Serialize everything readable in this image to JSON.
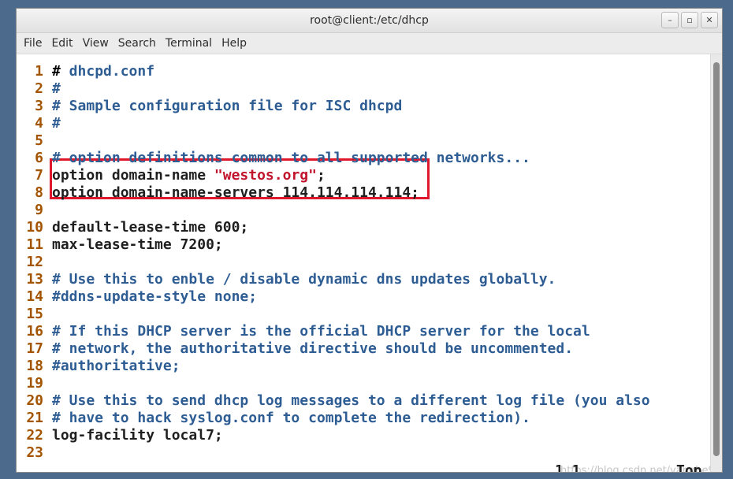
{
  "window": {
    "title": "root@client:/etc/dhcp",
    "buttons": {
      "minimize": "–",
      "maximize": "▫",
      "close": "✕"
    }
  },
  "menubar": {
    "items": [
      "File",
      "Edit",
      "View",
      "Search",
      "Terminal",
      "Help"
    ]
  },
  "editor": {
    "lines": [
      {
        "num": "1",
        "segments": [
          {
            "t": "#",
            "c": "cursor"
          },
          {
            "t": " dhcpd.conf",
            "c": "comment"
          }
        ]
      },
      {
        "num": "2",
        "segments": [
          {
            "t": "#",
            "c": "comment"
          }
        ]
      },
      {
        "num": "3",
        "segments": [
          {
            "t": "# Sample configuration file for ISC dhcpd",
            "c": "comment"
          }
        ]
      },
      {
        "num": "4",
        "segments": [
          {
            "t": "#",
            "c": "comment"
          }
        ]
      },
      {
        "num": "5",
        "segments": []
      },
      {
        "num": "6",
        "segments": [
          {
            "t": "# option definitions common to all supported networks...",
            "c": "comment"
          }
        ]
      },
      {
        "num": "7",
        "segments": [
          {
            "t": "option domain-name ",
            "c": "normal"
          },
          {
            "t": "\"westos.org\"",
            "c": "string"
          },
          {
            "t": ";",
            "c": "normal"
          }
        ]
      },
      {
        "num": "8",
        "segments": [
          {
            "t": "option domain-name-servers 114.114.114.114;",
            "c": "normal"
          }
        ]
      },
      {
        "num": "9",
        "segments": []
      },
      {
        "num": "10",
        "segments": [
          {
            "t": "default-lease-time 600;",
            "c": "normal"
          }
        ]
      },
      {
        "num": "11",
        "segments": [
          {
            "t": "max-lease-time 7200;",
            "c": "normal"
          }
        ]
      },
      {
        "num": "12",
        "segments": []
      },
      {
        "num": "13",
        "segments": [
          {
            "t": "# Use this to enble / disable dynamic dns updates globally.",
            "c": "comment"
          }
        ]
      },
      {
        "num": "14",
        "segments": [
          {
            "t": "#ddns-update-style none;",
            "c": "comment"
          }
        ]
      },
      {
        "num": "15",
        "segments": []
      },
      {
        "num": "16",
        "segments": [
          {
            "t": "# If this DHCP server is the official DHCP server for the local",
            "c": "comment"
          }
        ]
      },
      {
        "num": "17",
        "segments": [
          {
            "t": "# network, the authoritative directive should be uncommented.",
            "c": "comment"
          }
        ]
      },
      {
        "num": "18",
        "segments": [
          {
            "t": "#authoritative;",
            "c": "comment"
          }
        ]
      },
      {
        "num": "19",
        "segments": []
      },
      {
        "num": "20",
        "segments": [
          {
            "t": "# Use this to send dhcp log messages to a different log file (you also",
            "c": "comment"
          }
        ]
      },
      {
        "num": "21",
        "segments": [
          {
            "t": "# have to hack syslog.conf to complete the redirection).",
            "c": "comment"
          }
        ]
      },
      {
        "num": "22",
        "segments": [
          {
            "t": "log-facility local7;",
            "c": "normal"
          }
        ]
      },
      {
        "num": "23",
        "segments": []
      }
    ],
    "status": {
      "position": "1,1",
      "scroll": "Top"
    },
    "watermark": "https://blog.csdn.net/yanghe924"
  }
}
